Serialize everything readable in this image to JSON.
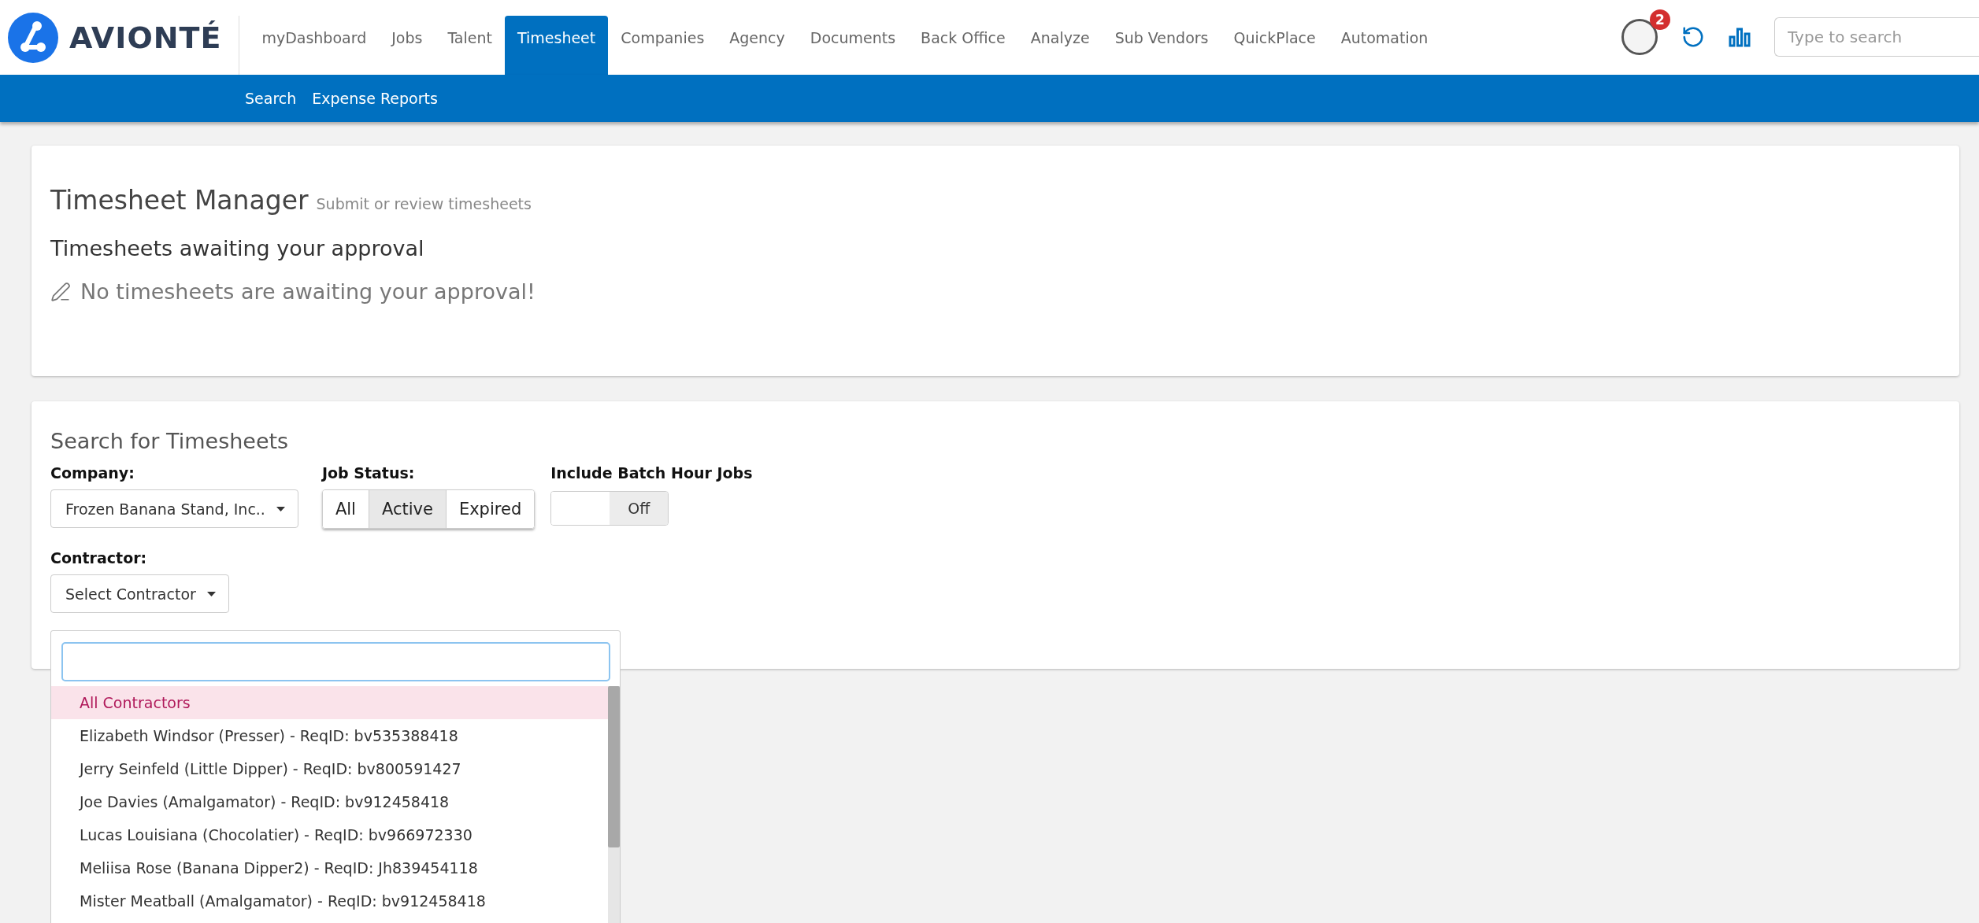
{
  "brand": {
    "name": "AVIONTÉ"
  },
  "nav": [
    {
      "label": "myDashboard",
      "selected": false
    },
    {
      "label": "Jobs",
      "selected": false
    },
    {
      "label": "Talent",
      "selected": false
    },
    {
      "label": "Timesheet",
      "selected": true
    },
    {
      "label": "Companies",
      "selected": false
    },
    {
      "label": "Agency",
      "selected": false
    },
    {
      "label": "Documents",
      "selected": false
    },
    {
      "label": "Back Office",
      "selected": false
    },
    {
      "label": "Analyze",
      "selected": false
    },
    {
      "label": "Sub Vendors",
      "selected": false
    },
    {
      "label": "QuickPlace",
      "selected": false
    },
    {
      "label": "Automation",
      "selected": false
    }
  ],
  "notifications": {
    "count": "2"
  },
  "search": {
    "placeholder": "Type to search"
  },
  "subnav": [
    {
      "label": "Search"
    },
    {
      "label": "Expense Reports"
    }
  ],
  "manager": {
    "title": "Timesheet Manager",
    "subtitle": "Submit or review timesheets",
    "heading": "Timesheets awaiting your approval",
    "message": "No timesheets are awaiting your approval!"
  },
  "search_form": {
    "title": "Search for Timesheets",
    "company": {
      "label": "Company:",
      "value": "Frozen Banana Stand, Inc.."
    },
    "job_status": {
      "label": "Job Status:",
      "options": [
        {
          "label": "All",
          "selected": false
        },
        {
          "label": "Active",
          "selected": true
        },
        {
          "label": "Expired",
          "selected": false
        }
      ]
    },
    "batch": {
      "label": "Include Batch Hour Jobs",
      "on": false,
      "state_text": "Off"
    },
    "contractor": {
      "label": "Contractor:",
      "value": "Select Contractor"
    },
    "dropdown": {
      "items": [
        {
          "label": "All Contractors",
          "selected": true
        },
        {
          "label": "Elizabeth Windsor (Presser) - ReqID: bv535388418",
          "selected": false
        },
        {
          "label": "Jerry Seinfeld (Little Dipper) - ReqID: bv800591427",
          "selected": false
        },
        {
          "label": "Joe Davies (Amalgamator) - ReqID: bv912458418",
          "selected": false
        },
        {
          "label": "Lucas Louisiana (Chocolatier) - ReqID: bv966972330",
          "selected": false
        },
        {
          "label": "Meliisa Rose (Banana Dipper2) - ReqID: Jh839454118",
          "selected": false
        },
        {
          "label": "Mister Meatball (Amalgamator) - ReqID: bv912458418",
          "selected": false
        }
      ]
    }
  }
}
